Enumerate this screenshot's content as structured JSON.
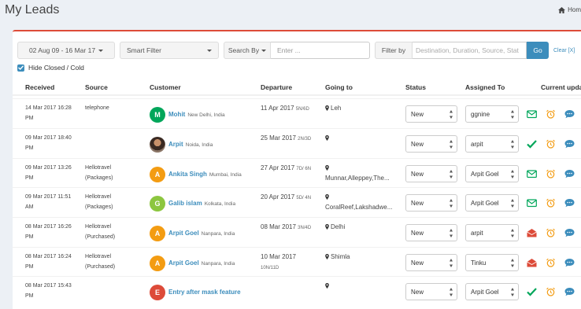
{
  "page": {
    "title": "My Leads",
    "breadcrumb": "Hom"
  },
  "filters": {
    "date_range": "02 Aug 09 - 16 Mar 17",
    "smart_filter": "Smart Filter",
    "search_by": "Search By",
    "search_placeholder": "Enter ...",
    "filter_by": "Filter by",
    "destination_placeholder": "Destination, Duration, Source, Stat",
    "go": "Go",
    "clear": "Clear [X]",
    "hide_closed": "Hide Closed / Cold"
  },
  "table": {
    "headers": {
      "received": "Received",
      "source": "Source",
      "customer": "Customer",
      "departure": "Departure",
      "going_to": "Going to",
      "status": "Status",
      "assigned_to": "Assigned To",
      "current_update": "Current upda"
    },
    "rows": [
      {
        "received_1": "14 Mar 2017 16:28",
        "received_2": "PM",
        "source_1": "telephone",
        "source_2": "",
        "initial": "M",
        "avatar_color": "#00a65a",
        "name": "Mohit",
        "location": "New Delhi, India",
        "departure": "11 Apr 2017",
        "departure_inline": "5N/6D",
        "departure_below": "",
        "going_1": "Leh",
        "going_2": "",
        "status": "New",
        "assigned": "ggnine",
        "mail": "open"
      },
      {
        "received_1": "09 Mar 2017 18:40",
        "received_2": "PM",
        "source_1": "",
        "source_2": "",
        "initial": "",
        "avatar_color": "photo",
        "name": "Arpit",
        "location": "Noida, India",
        "departure": "25 Mar 2017",
        "departure_inline": "2N/3D",
        "departure_below": "",
        "going_1": "",
        "going_2": "",
        "status": "New",
        "assigned": "arpit",
        "mail": "check"
      },
      {
        "received_1": "09 Mar 2017 13:26",
        "received_2": "PM",
        "source_1": "Hellotravel",
        "source_2": "(Packages)",
        "initial": "A",
        "avatar_color": "#f39c12",
        "name": "Ankita Singh",
        "location": "Mumbai, India",
        "departure": "27 Apr 2017",
        "departure_inline": "7D/ 6N",
        "departure_below": "",
        "going_1": "",
        "going_2": "Munnar,Alleppey,The...",
        "status": "New",
        "assigned": "Arpit Goel",
        "mail": "open"
      },
      {
        "received_1": "09 Mar 2017 11:51",
        "received_2": "AM",
        "source_1": "Hellotravel",
        "source_2": "(Packages)",
        "initial": "G",
        "avatar_color": "#8cc63f",
        "name": "Galib islam",
        "location": "Kolkata, India",
        "departure": "20 Apr 2017",
        "departure_inline": "5D/ 4N",
        "departure_below": "",
        "going_1": "",
        "going_2": "CoralReef,Lakshadwe...",
        "status": "New",
        "assigned": "Arpit Goel",
        "mail": "open"
      },
      {
        "received_1": "08 Mar 2017 16:26",
        "received_2": "PM",
        "source_1": "Hellotravel",
        "source_2": "(Purchased)",
        "initial": "A",
        "avatar_color": "#f39c12",
        "name": "Arpit Goel",
        "location": "Nanpara, India",
        "departure": "08 Mar 2017",
        "departure_inline": "3N/4D",
        "departure_below": "",
        "going_1": "Delhi",
        "going_2": "",
        "status": "New",
        "assigned": "arpit",
        "mail": "red"
      },
      {
        "received_1": "08 Mar 2017 16:24",
        "received_2": "PM",
        "source_1": "Hellotravel",
        "source_2": "(Purchased)",
        "initial": "A",
        "avatar_color": "#f39c12",
        "name": "Arpit Goel",
        "location": "Nanpara, India",
        "departure": "10 Mar 2017",
        "departure_inline": "",
        "departure_below": "10N/11D",
        "going_1": "Shimla",
        "going_2": "",
        "status": "New",
        "assigned": "Tinku",
        "mail": "red"
      },
      {
        "received_1": "08 Mar 2017 15:43",
        "received_2": "PM",
        "source_1": "",
        "source_2": "",
        "initial": "E",
        "avatar_color": "#dd4b39",
        "name": "Entry after mask feature",
        "location": "",
        "departure": "",
        "departure_inline": "",
        "departure_below": "",
        "going_1": "",
        "going_2": "",
        "status": "New",
        "assigned": "Arpit Goel",
        "mail": "check"
      }
    ]
  },
  "colors": {
    "accent": "#3c8dbc",
    "danger": "#dd4b39",
    "success": "#00a65a",
    "warning": "#f39c12"
  }
}
